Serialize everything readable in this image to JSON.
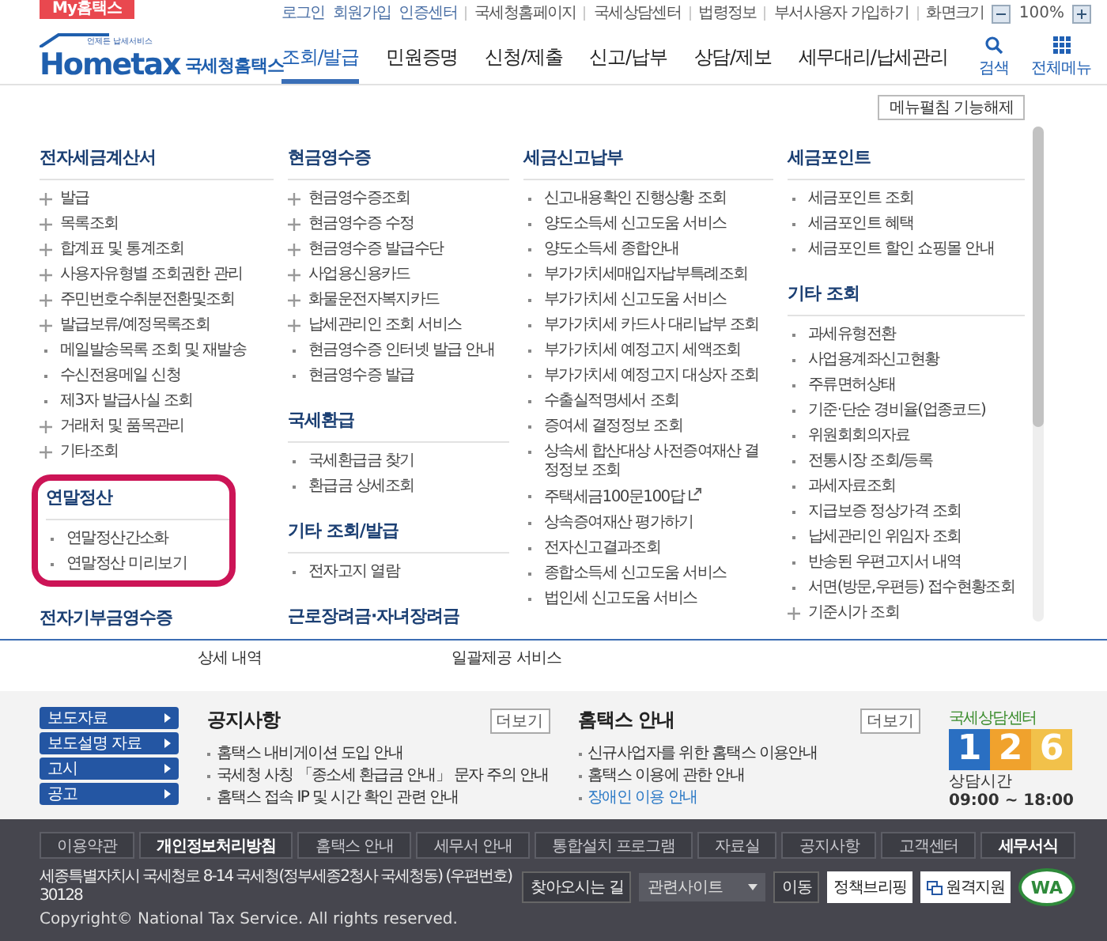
{
  "top_bar": {
    "my_tab": "My홈택스",
    "links": [
      "로그인",
      "회원가입",
      "인증센터",
      "국세청홈페이지",
      "국세상담센터",
      "법령정보",
      "부서사용자 가입하기",
      "화면크기"
    ],
    "zoom": "100%"
  },
  "header": {
    "logo": {
      "tagline": "언제든 납세서비스",
      "wordmark": "Hometax",
      "name": "국세청홈택스"
    },
    "nav": [
      {
        "label": "조회/발급",
        "selected": true
      },
      {
        "label": "민원증명",
        "selected": false
      },
      {
        "label": "신청/제출",
        "selected": false
      },
      {
        "label": "신고/납부",
        "selected": false
      },
      {
        "label": "상담/제보",
        "selected": false
      },
      {
        "label": "세무대리/납세관리",
        "selected": false
      }
    ],
    "tools": [
      {
        "label": "검색",
        "kind": "search"
      },
      {
        "label": "전체메뉴",
        "kind": "grid"
      }
    ]
  },
  "menu": {
    "collapse_button": "메뉴펼침 기능해제",
    "columns": [
      {
        "groups": [
          {
            "title": "전자세금계산서",
            "highlighted": false,
            "items": [
              {
                "label": "발급",
                "kind": "submenu"
              },
              {
                "label": "목록조회",
                "kind": "submenu"
              },
              {
                "label": "합계표 및 통계조회",
                "kind": "submenu"
              },
              {
                "label": "사용자유형별 조회권한 관리",
                "kind": "submenu"
              },
              {
                "label": "주민번호수취분전환및조회",
                "kind": "submenu"
              },
              {
                "label": "발급보류/예정목록조회",
                "kind": "submenu"
              },
              {
                "label": "메일발송목록 조회 및 재발송",
                "kind": "link"
              },
              {
                "label": "수신전용메일 신청",
                "kind": "link"
              },
              {
                "label": "제3자 발급사실 조회",
                "kind": "link"
              },
              {
                "label": "거래처 및 품목관리",
                "kind": "submenu"
              },
              {
                "label": "기타조회",
                "kind": "submenu"
              }
            ]
          },
          {
            "title": "연말정산",
            "highlighted": true,
            "items": [
              {
                "label": "연말정산간소화",
                "kind": "link"
              },
              {
                "label": "연말정산 미리보기",
                "kind": "link"
              }
            ]
          },
          {
            "title": "전자기부금영수증",
            "highlighted": false
          }
        ]
      },
      {
        "groups": [
          {
            "title": "현금영수증",
            "highlighted": false,
            "items": [
              {
                "label": "현금영수증조회",
                "kind": "submenu"
              },
              {
                "label": "현금영수증 수정",
                "kind": "submenu"
              },
              {
                "label": "현금영수증 발급수단",
                "kind": "submenu"
              },
              {
                "label": "사업용신용카드",
                "kind": "submenu"
              },
              {
                "label": "화물운전자복지카드",
                "kind": "submenu"
              },
              {
                "label": "납세관리인 조회 서비스",
                "kind": "submenu"
              },
              {
                "label": "현금영수증 인터넷 발급 안내",
                "kind": "link"
              },
              {
                "label": "현금영수증 발급",
                "kind": "link"
              }
            ]
          },
          {
            "title": "국세환급",
            "highlighted": false,
            "items": [
              {
                "label": "국세환급금 찾기",
                "kind": "link"
              },
              {
                "label": "환급금 상세조회",
                "kind": "link"
              }
            ]
          },
          {
            "title": "기타 조회/발급",
            "highlighted": false,
            "items": [
              {
                "label": "전자고지 열람",
                "kind": "link"
              }
            ]
          },
          {
            "title": "근로장려금·자녀장려금",
            "highlighted": false
          }
        ]
      },
      {
        "groups": [
          {
            "title": "세금신고납부",
            "highlighted": false,
            "items": [
              {
                "label": "신고내용확인 진행상황 조회",
                "kind": "link"
              },
              {
                "label": "양도소득세 신고도움 서비스",
                "kind": "link"
              },
              {
                "label": "양도소득세 종합안내",
                "kind": "link"
              },
              {
                "label": "부가가치세매입자납부특례조회",
                "kind": "link"
              },
              {
                "label": "부가가치세 신고도움 서비스",
                "kind": "link"
              },
              {
                "label": "부가가치세 카드사 대리납부 조회",
                "kind": "link"
              },
              {
                "label": "부가가치세 예정고지 세액조회",
                "kind": "link"
              },
              {
                "label": "부가가치세 예정고지 대상자 조회",
                "kind": "link"
              },
              {
                "label": "수출실적명세서 조회",
                "kind": "link"
              },
              {
                "label": "증여세 결정정보 조회",
                "kind": "link"
              },
              {
                "label": "상속세 합산대상 사전증여재산 결정정보 조회",
                "kind": "link"
              },
              {
                "label": "주택세금100문100답",
                "kind": "external"
              },
              {
                "label": "상속증여재산 평가하기",
                "kind": "link"
              },
              {
                "label": "전자신고결과조회",
                "kind": "link"
              },
              {
                "label": "종합소득세 신고도움 서비스",
                "kind": "link"
              },
              {
                "label": "법인세 신고도움 서비스",
                "kind": "link"
              }
            ]
          }
        ]
      },
      {
        "groups": [
          {
            "title": "세금포인트",
            "highlighted": false,
            "items": [
              {
                "label": "세금포인트 조회",
                "kind": "link"
              },
              {
                "label": "세금포인트 혜택",
                "kind": "link"
              },
              {
                "label": "세금포인트 할인 쇼핑몰 안내",
                "kind": "link"
              }
            ]
          },
          {
            "title": "기타 조회",
            "highlighted": false,
            "items": [
              {
                "label": "과세유형전환",
                "kind": "link"
              },
              {
                "label": "사업용계좌신고현황",
                "kind": "link"
              },
              {
                "label": "주류면허상태",
                "kind": "link"
              },
              {
                "label": "기준·단순 경비율(업종코드)",
                "kind": "link"
              },
              {
                "label": "위원회회의자료",
                "kind": "link"
              },
              {
                "label": "전통시장 조회/등록",
                "kind": "link"
              },
              {
                "label": "과세자료조회",
                "kind": "link"
              },
              {
                "label": "지급보증 정상가격 조회",
                "kind": "link"
              },
              {
                "label": "납세관리인 위임자 조회",
                "kind": "link"
              },
              {
                "label": "반송된 우편고지서 내역",
                "kind": "link"
              },
              {
                "label": "서면(방문,우편등) 접수현황조회",
                "kind": "link"
              },
              {
                "label": "기준시가 조회",
                "kind": "submenu"
              }
            ]
          }
        ]
      }
    ]
  },
  "under_strip": [
    "상세 내역",
    "일괄제공 서비스"
  ],
  "notice_area": {
    "side_buttons": [
      "보도자료",
      "보도설명 자료",
      "고시",
      "공고"
    ],
    "boards": [
      {
        "title": "공지사항",
        "more": "더보기",
        "items": [
          {
            "text": "홈택스 내비게이션 도입 안내",
            "kind": "plain"
          },
          {
            "text": "국세청 사칭 「종소세 환급금 안내」 문자 주의 안내",
            "kind": "plain"
          },
          {
            "text": "홈택스 접속 IP 및 시간 확인 관련 안내",
            "kind": "plain"
          }
        ]
      },
      {
        "title": "홈택스 안내",
        "more": "더보기",
        "items": [
          {
            "text": "신규사업자를 위한 홈택스 이용안내",
            "kind": "plain"
          },
          {
            "text": "홈택스 이용에 관한 안내",
            "kind": "plain"
          },
          {
            "text": "장애인 이용 안내",
            "kind": "link"
          }
        ]
      }
    ],
    "call_center": {
      "title": "국세상담센터",
      "digits": [
        "1",
        "2",
        "6"
      ],
      "hours_label": "상담시간",
      "hours": "09:00 ~ 18:00"
    }
  },
  "footer": {
    "links": [
      {
        "label": "이용약관",
        "emphasized": false
      },
      {
        "label": "개인정보처리방침",
        "emphasized": true
      },
      {
        "label": "홈택스 안내",
        "emphasized": false
      },
      {
        "label": "세무서 안내",
        "emphasized": false
      },
      {
        "label": "통합설치 프로그램",
        "emphasized": false
      },
      {
        "label": "자료실",
        "emphasized": false
      },
      {
        "label": "공지사항",
        "emphasized": false
      },
      {
        "label": "고객센터",
        "emphasized": false
      },
      {
        "label": "세무서식",
        "emphasized": true
      }
    ],
    "address": "세종특별자치시 국세청로 8-14 국세청(정부세종2청사 국세청동) (우편번호) 30128",
    "directions": "찾아오시는 길",
    "site_select": "관련사이트",
    "go": "이동",
    "briefing": "정책브리핑",
    "remote": "원격지원",
    "wa_mark": "WA",
    "copyright": "Copyright© National Tax Service. All rights reserved."
  }
}
